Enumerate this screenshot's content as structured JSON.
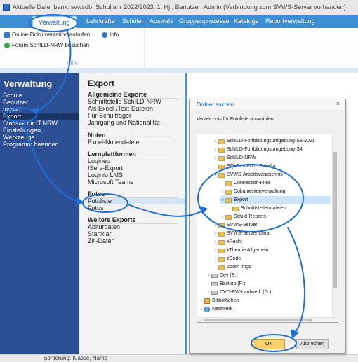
{
  "window": {
    "title": "Aktuelle Datenbank: svwsdb, Schuljahr 2022/2023, 1. Hj., Benutzer: Admin (Verbindung zum SVWS-Server vorhanden)"
  },
  "menu": {
    "tabs": [
      "Verwaltung",
      "Lehrkräfte",
      "Schüler",
      "Auswahl",
      "Gruppenprozesse",
      "Kataloge",
      "Reportverwaltung"
    ],
    "active": "Verwaltung"
  },
  "ribbon": {
    "online_doc": "Online-Dokumentation aufrufen",
    "info": "Info",
    "forum": "Forum SchILD-NRW besuchen",
    "group_label": "Hilfe"
  },
  "leftnav": {
    "title": "Verwaltung",
    "items": [
      "Schule",
      "Benutzer",
      "Import",
      "Export",
      "Statistik für IT.NRW",
      "Einstellungen",
      "Werkzeuge",
      "Programm beenden"
    ],
    "selected": "Export"
  },
  "midpanel": {
    "title": "Export",
    "sections": [
      {
        "title": "Allgemeine Exporte",
        "items": [
          "Schnittstelle SchILD-NRW",
          "Als Excel-/Text-Dateien",
          "Für Schulträger",
          "Jahrgang und Nationalität"
        ]
      },
      {
        "title": "Noten",
        "items": [
          "Excel-Notendateien"
        ]
      },
      {
        "title": "Lernplattformen",
        "items": [
          "Loqineo",
          "IServ-Export",
          "Loqinio LMS",
          "Microsoft Teams"
        ]
      },
      {
        "title": "Fotos",
        "items": [
          "Fotoliste",
          "Fotos"
        ]
      },
      {
        "title": "Weitere Exporte",
        "items": [
          "Abiturdaten",
          "Startklar",
          "ZK-Daten"
        ]
      }
    ],
    "selected": "Fotoliste"
  },
  "dialog": {
    "title": "Ordner suchen",
    "close": "×",
    "description": "Verzeichnis für Fotoliste auswählen",
    "tree": [
      {
        "label": "SchILD-Fortbildungsumgebung-S3-2021",
        "depth": 2,
        "type": "folder",
        "arrow": ">"
      },
      {
        "label": "SchILD-Fortbildungsumgebung-S4",
        "depth": 2,
        "type": "folder",
        "arrow": ">"
      },
      {
        "label": "SchILD-NRW",
        "depth": 2,
        "type": "folder",
        "arrow": ">"
      },
      {
        "label": "SQLServer2017Media",
        "depth": 2,
        "type": "folder",
        "arrow": ""
      },
      {
        "label": "SVWS-Arbeitsverzeichnis",
        "depth": 2,
        "type": "folder",
        "arrow": "v"
      },
      {
        "label": "Connection-Files",
        "depth": 3,
        "type": "folder",
        "arrow": ""
      },
      {
        "label": "Dokumentenverwaltung",
        "depth": 3,
        "type": "folder",
        "arrow": ">"
      },
      {
        "label": "Export",
        "depth": 3,
        "type": "folder",
        "arrow": "v",
        "selected": true
      },
      {
        "label": "Schnittstellendateien",
        "depth": 4,
        "type": "folder",
        "arrow": ""
      },
      {
        "label": "Schild-Reports",
        "depth": 3,
        "type": "folder",
        "arrow": ">"
      },
      {
        "label": "SVWS-Server",
        "depth": 2,
        "type": "folder",
        "arrow": ">"
      },
      {
        "label": "SVWS-Server-Data",
        "depth": 2,
        "type": "folder",
        "arrow": ">"
      },
      {
        "label": "xRecht",
        "depth": 2,
        "type": "folder",
        "arrow": ">"
      },
      {
        "label": "xTheorie Allgemein",
        "depth": 2,
        "type": "folder",
        "arrow": ">"
      },
      {
        "label": "zCode",
        "depth": 2,
        "type": "folder",
        "arrow": ">"
      },
      {
        "label": "Zoom imgs",
        "depth": 2,
        "type": "folder",
        "arrow": ""
      },
      {
        "label": "Dev (E:)",
        "depth": 1,
        "type": "drive",
        "arrow": ">"
      },
      {
        "label": "Backup (F:)",
        "depth": 1,
        "type": "drive",
        "arrow": ">"
      },
      {
        "label": "DVD-RW-Laufwerk (G:)",
        "depth": 1,
        "type": "drive",
        "arrow": ">"
      },
      {
        "label": "Bibliotheken",
        "depth": 0,
        "type": "library",
        "arrow": ">"
      },
      {
        "label": "Netzwerk",
        "depth": 0,
        "type": "network",
        "arrow": ">"
      }
    ],
    "ok": "OK",
    "cancel": "Abbrechen"
  },
  "statusbar": {
    "text": "Sortierung: Klasse, Name"
  },
  "colors": {
    "menu_blue": "#3d8fd4",
    "nav_blue": "#2c4f96",
    "highlight_blue": "#1f6ed4",
    "ok_yellow": "#fbd26b"
  }
}
